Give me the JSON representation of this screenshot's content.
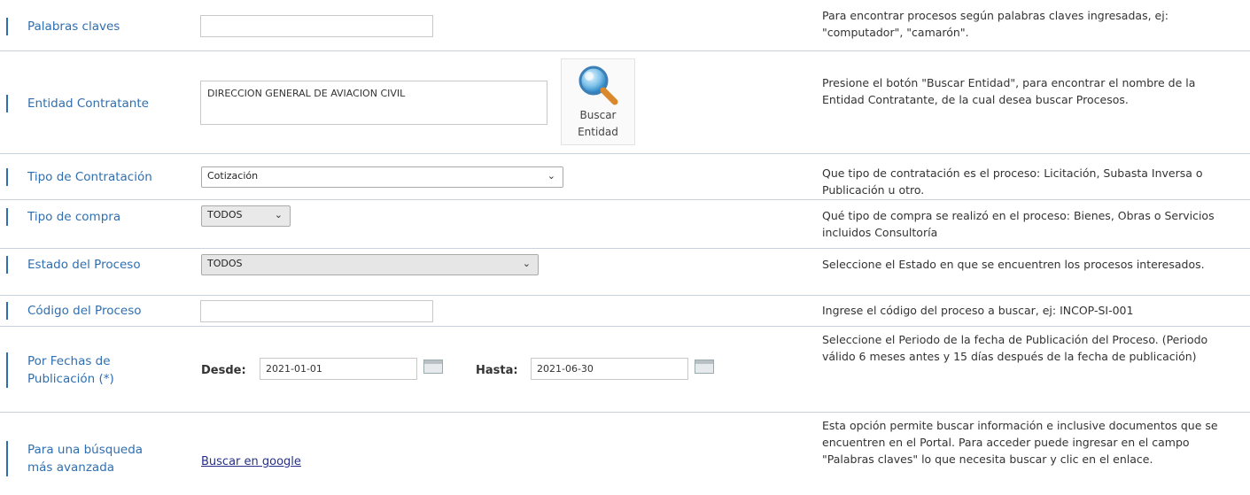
{
  "rows": {
    "keywords": {
      "label": "Palabras claves",
      "value": "",
      "help": "Para encontrar procesos según palabras claves ingresadas, ej: \"computador\", \"camarón\"."
    },
    "entity": {
      "label": "Entidad Contratante",
      "value": "DIRECCION GENERAL DE AVIACION CIVIL",
      "button_label": "Buscar Entidad",
      "help": "Presione el botón \"Buscar Entidad\", para encontrar el nombre de la Entidad Contratante, de la cual desea buscar Procesos."
    },
    "contract_type": {
      "label": "Tipo de Contratación",
      "value": "Cotización",
      "help": "Que tipo de contratación es el proceso: Licitación, Subasta Inversa o Publicación u otro."
    },
    "purchase_type": {
      "label": "Tipo de compra",
      "value": "TODOS",
      "help": "Qué tipo de compra se realizó en el proceso: Bienes, Obras o Servicios incluidos Consultoría"
    },
    "process_state": {
      "label": "Estado del Proceso",
      "value": "TODOS",
      "help": "Seleccione el Estado en que se encuentren los procesos interesados."
    },
    "process_code": {
      "label": "Código del Proceso",
      "value": "",
      "help": "Ingrese el código del proceso a buscar, ej: INCOP-SI-001"
    },
    "dates": {
      "label": "Por Fechas de Publicación (*)",
      "from_label": "Desde:",
      "from_value": "2021-01-01",
      "to_label": "Hasta:",
      "to_value": "2021-06-30",
      "help": "Seleccione el Periodo de la fecha de Publicación del Proceso. (Periodo válido 6 meses antes y 15 días después de la fecha de publicación)"
    },
    "advanced": {
      "label": "Para una búsqueda más avanzada",
      "link_text": "Buscar en google",
      "help": "Esta opción permite buscar información e inclusive documentos que se encuentren en el Portal. Para acceder puede ingresar en el campo \"Palabras claves\" lo que necesita buscar y clic en el enlace."
    }
  },
  "icons": {
    "search_entity": "magnifier-icon",
    "calendar": "calendar-icon",
    "dropdown": "chevron-down-icon"
  },
  "colors": {
    "label_blue": "#2f6fb0",
    "link_blue": "#26308a",
    "row_border": "#c9d3dd",
    "disabled_select": "#e9e9e9"
  }
}
